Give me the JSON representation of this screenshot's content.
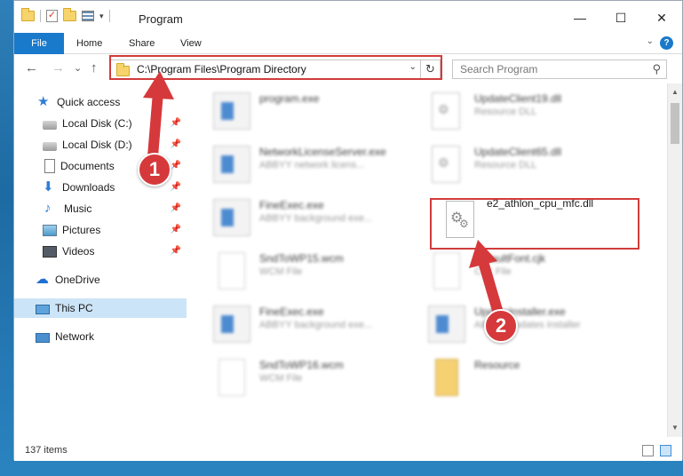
{
  "window": {
    "title": "Program",
    "controls": {
      "minimize": "—",
      "maximize": "☐",
      "close": "✕"
    }
  },
  "ribbon": {
    "tabs": [
      {
        "label": "File"
      },
      {
        "label": "Home"
      },
      {
        "label": "Share"
      },
      {
        "label": "View"
      }
    ],
    "help": "?"
  },
  "nav": {
    "back": "←",
    "forward": "→",
    "recent": "⌄",
    "up": "↑",
    "address": "C:\\Program Files\\Program Directory",
    "search_placeholder": "Search Program"
  },
  "sidebar": {
    "items": [
      {
        "label": "Quick access",
        "icon": "star-icon"
      },
      {
        "label": "Local Disk (C:)",
        "icon": "disk-icon"
      },
      {
        "label": "Local Disk (D:)",
        "icon": "disk-icon"
      },
      {
        "label": "Documents",
        "icon": "document-icon"
      },
      {
        "label": "Downloads",
        "icon": "download-icon"
      },
      {
        "label": "Music",
        "icon": "music-icon"
      },
      {
        "label": "Pictures",
        "icon": "picture-icon"
      },
      {
        "label": "Videos",
        "icon": "video-icon"
      },
      {
        "label": "OneDrive",
        "icon": "cloud-icon"
      },
      {
        "label": "This PC",
        "icon": "computer-icon"
      },
      {
        "label": "Network",
        "icon": "network-icon"
      }
    ]
  },
  "files": {
    "items": [
      {
        "name": "program.exe",
        "desc": ""
      },
      {
        "name": "UpdateClient19.dll",
        "desc": "Resource DLL"
      },
      {
        "name": "NetworkLicenseServer.exe",
        "desc": "ABBYY network licens..."
      },
      {
        "name": "UpdateClient65.dll",
        "desc": "Resource DLL"
      },
      {
        "name": "FineExec.exe",
        "desc": "ABBYY background exe..."
      },
      {
        "name": "e2_athlon_cpu_mfc.dll",
        "desc": ""
      },
      {
        "name": "SndToWP15.wcm",
        "desc": "WCM File"
      },
      {
        "name": "DefaultFont.cjk",
        "desc": "CJK File"
      },
      {
        "name": "FineExec.exe",
        "desc": "ABBYY background exe..."
      },
      {
        "name": "UpdateInstaller.exe",
        "desc": "ABBYY updates installer"
      },
      {
        "name": "SndToWP16.wcm",
        "desc": "WCM File"
      },
      {
        "name": "Resource",
        "desc": ""
      }
    ]
  },
  "status": {
    "item_count": "137 items"
  },
  "annotations": {
    "step1": "1",
    "step2": "2"
  },
  "colors": {
    "accent": "#1979ca",
    "highlight": "#d23b3b",
    "selection": "#cce4f7"
  }
}
